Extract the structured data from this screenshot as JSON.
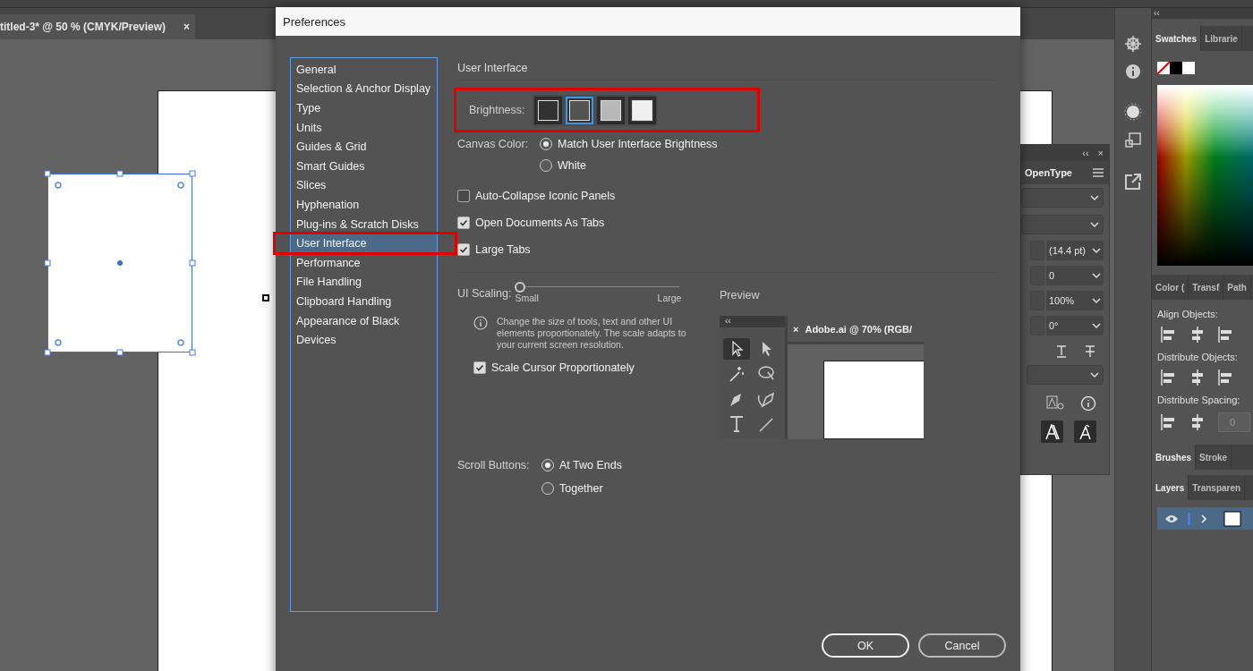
{
  "document_tab": {
    "title": "titled-3* @ 50 % (CMYK/Preview)",
    "close": "×"
  },
  "character_panel": {
    "collapse": "‹‹",
    "close": "×",
    "tab": "OpenType",
    "fields": [
      {
        "value": "(14.4 pt)"
      },
      {
        "value": "0"
      },
      {
        "value": "100%"
      },
      {
        "value": "0°"
      }
    ]
  },
  "right_panels": {
    "collapse": "‹‹",
    "top_tabs": [
      {
        "label": "Swatches",
        "selected": true
      },
      {
        "label": "Librarie",
        "selected": false
      }
    ],
    "middle_tabs": [
      {
        "label": "Color (",
        "selected": false
      },
      {
        "label": "Transf",
        "selected": false
      },
      {
        "label": "Path",
        "selected": false
      }
    ],
    "align_sections": [
      {
        "label": "Align Objects:"
      },
      {
        "label": "Distribute Objects:"
      },
      {
        "label": "Distribute Spacing:",
        "field": "0"
      }
    ],
    "brush_tabs": [
      {
        "label": "Brushes",
        "selected": true
      },
      {
        "label": "Stroke",
        "selected": false
      }
    ],
    "layer_tabs": [
      {
        "label": "Layers",
        "selected": true
      },
      {
        "label": "Transparen",
        "selected": false
      }
    ]
  },
  "dialog": {
    "title": "Preferences",
    "categories": [
      {
        "label": "General",
        "selected": false
      },
      {
        "label": "Selection & Anchor Display",
        "selected": false
      },
      {
        "label": "Type",
        "selected": false
      },
      {
        "label": "Units",
        "selected": false
      },
      {
        "label": "Guides & Grid",
        "selected": false
      },
      {
        "label": "Smart Guides",
        "selected": false
      },
      {
        "label": "Slices",
        "selected": false
      },
      {
        "label": "Hyphenation",
        "selected": false
      },
      {
        "label": "Plug-ins & Scratch Disks",
        "selected": false
      },
      {
        "label": "User Interface",
        "selected": true
      },
      {
        "label": "Performance",
        "selected": false
      },
      {
        "label": "File Handling",
        "selected": false
      },
      {
        "label": "Clipboard Handling",
        "selected": false
      },
      {
        "label": "Appearance of Black",
        "selected": false
      },
      {
        "label": "Devices",
        "selected": false
      }
    ],
    "section_title": "User Interface",
    "brightness": {
      "label": "Brightness:",
      "highlighted": true,
      "options": [
        {
          "color": "#323232",
          "selected": false
        },
        {
          "color": "#535353",
          "selected": true
        },
        {
          "color": "#b8b8b8",
          "selected": false
        },
        {
          "color": "#f0f0f0",
          "selected": false
        }
      ]
    },
    "canvas_color": {
      "label": "Canvas Color:",
      "options": [
        {
          "label": "Match User Interface Brightness",
          "selected": true
        },
        {
          "label": "White",
          "selected": false
        }
      ]
    },
    "checkboxes": [
      {
        "label": "Auto-Collapse Iconic Panels",
        "checked": false
      },
      {
        "label": "Open Documents As Tabs",
        "checked": true
      },
      {
        "label": "Large Tabs",
        "checked": true
      }
    ],
    "ui_scaling": {
      "label": "UI Scaling:",
      "level": 0,
      "min_label": "Small",
      "max_label": "Large",
      "info": "Change the size of tools, text and other UI elements proportionately. The scale adapts to your current screen resolution.",
      "scale_cursor": {
        "label": "Scale Cursor Proportionately",
        "checked": true
      }
    },
    "preview": {
      "label": "Preview",
      "collapse": "‹‹",
      "close": "×",
      "document": "Adobe.ai @ 70% (RGB/"
    },
    "scroll_buttons": {
      "label": "Scroll Buttons:",
      "options": [
        {
          "label": "At Two Ends",
          "selected": true
        },
        {
          "label": "Together",
          "selected": false
        }
      ]
    },
    "buttons": [
      {
        "label": "OK",
        "kind": "primary"
      },
      {
        "label": "Cancel",
        "kind": "secondary"
      }
    ]
  }
}
